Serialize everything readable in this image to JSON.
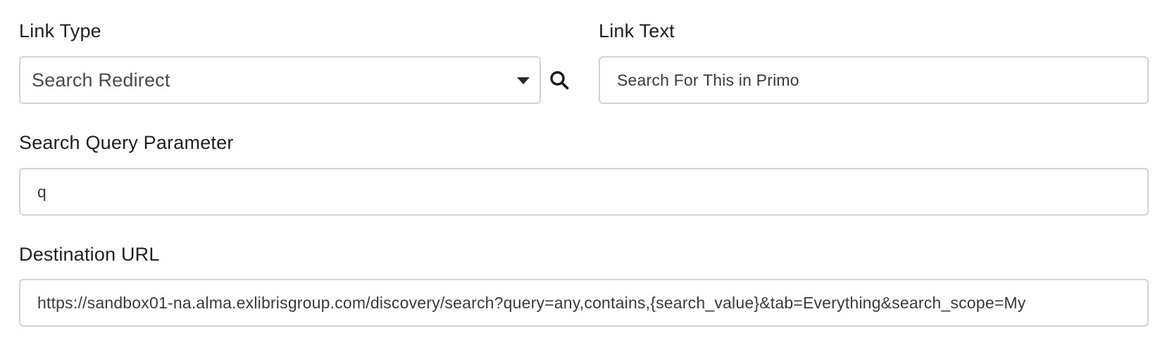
{
  "link_type": {
    "label": "Link Type",
    "selected": "Search Redirect",
    "caret_icon": "caret-down-icon",
    "search_icon": "search-icon"
  },
  "link_text": {
    "label": "Link Text",
    "value": "Search For This in Primo"
  },
  "search_query_parameter": {
    "label": "Search Query Parameter",
    "value": "q"
  },
  "destination_url": {
    "label": "Destination URL",
    "value": "https://sandbox01-na.alma.exlibrisgroup.com/discovery/search?query=any,contains,{search_value}&tab=Everything&search_scope=My"
  }
}
